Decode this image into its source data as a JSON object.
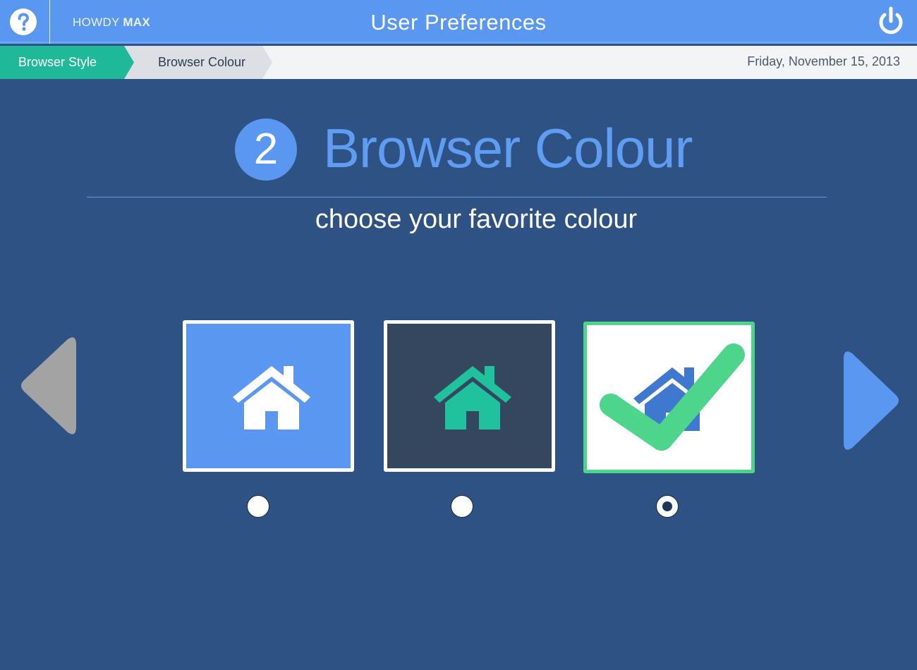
{
  "header": {
    "greeting_prefix": "HOWDY",
    "greeting_name": "MAX",
    "title": "User Preferences",
    "help_icon": "question-circle-icon",
    "power_icon": "power-icon"
  },
  "breadcrumb": {
    "items": [
      {
        "label": "Browser Style",
        "state": "completed",
        "color": "#1fb99a"
      },
      {
        "label": "Browser Colour",
        "state": "current",
        "color": "#dcdfe3"
      }
    ],
    "date": "Friday, November 15, 2013"
  },
  "step": {
    "number": "2",
    "title": "Browser Colour",
    "subtitle": "choose your favorite colour"
  },
  "navigation": {
    "previous_icon": "chevron-left-icon",
    "previous_enabled": false,
    "next_icon": "chevron-right-icon",
    "next_enabled": true
  },
  "options": [
    {
      "icon": "home-icon",
      "background": "#5a97f1",
      "icon_color": "#ffffff",
      "selected": false
    },
    {
      "icon": "home-icon",
      "background": "#34475f",
      "icon_color": "#1fc29c",
      "selected": false
    },
    {
      "icon": "home-icon",
      "background": "#ffffff",
      "icon_color": "#3f78cf",
      "selected": true,
      "badge_icon": "checkmark-icon",
      "badge_color": "#4cd58b"
    }
  ],
  "colors": {
    "topbar": "#5a97f1",
    "page_background": "#2e5284",
    "accent": "#5f9df2",
    "success": "#4cd58b"
  }
}
